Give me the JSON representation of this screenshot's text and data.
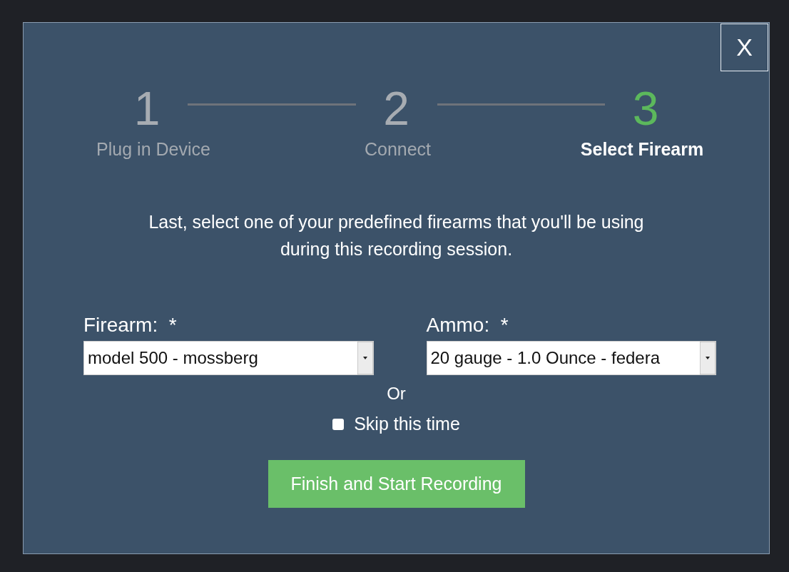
{
  "dialog": {
    "close_label": "X"
  },
  "steps": [
    {
      "number": "1",
      "label": "Plug in Device",
      "selected": false
    },
    {
      "number": "2",
      "label": "Connect",
      "selected": false
    },
    {
      "number": "3",
      "label": "Select Firearm",
      "selected": true
    }
  ],
  "instruction": "Last, select one of your predefined firearms that you'll be using during this recording session.",
  "fields": [
    {
      "label": "Firearm:  *",
      "value": "model 500 - mossberg"
    },
    {
      "label": "Ammo:  *",
      "value": "20 gauge - 1.0 Ounce - federa"
    }
  ],
  "separator": "Or",
  "skip": {
    "label": "Skip this time",
    "checked": false
  },
  "primary_button": "Finish and Start Recording"
}
